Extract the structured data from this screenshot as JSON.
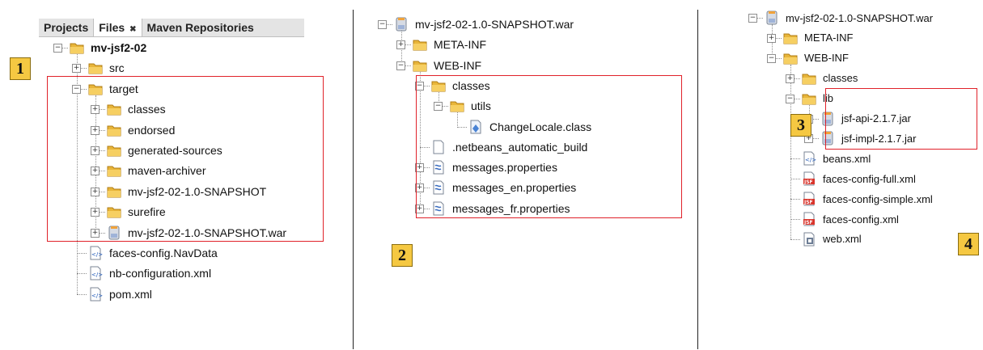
{
  "tabs": [
    {
      "label": "Projects",
      "close": ""
    },
    {
      "label": "Files",
      "close": "✖"
    },
    {
      "label": "Maven Repositories",
      "close": ""
    }
  ],
  "callouts": [
    "1",
    "2",
    "3",
    "4"
  ],
  "panel1": {
    "rows": [
      {
        "label": "mv-jsf2-02",
        "icon": "folder-icon",
        "bold": true,
        "exp": "−"
      },
      {
        "label": "src",
        "icon": "folder-icon",
        "exp": "+"
      },
      {
        "label": "target",
        "icon": "folder-icon",
        "exp": "−"
      },
      {
        "label": "classes",
        "icon": "folder-icon",
        "exp": "+"
      },
      {
        "label": "endorsed",
        "icon": "folder-icon",
        "exp": "+"
      },
      {
        "label": "generated-sources",
        "icon": "folder-icon",
        "exp": "+"
      },
      {
        "label": "maven-archiver",
        "icon": "folder-icon",
        "exp": "+"
      },
      {
        "label": "mv-jsf2-02-1.0-SNAPSHOT",
        "icon": "folder-icon",
        "exp": "+"
      },
      {
        "label": "surefire",
        "icon": "folder-icon",
        "exp": "+"
      },
      {
        "label": "mv-jsf2-02-1.0-SNAPSHOT.war",
        "icon": "jar-icon",
        "exp": "+"
      },
      {
        "label": "faces-config.NavData",
        "icon": "xml-file-icon",
        "exp": ""
      },
      {
        "label": "nb-configuration.xml",
        "icon": "xml-file-icon",
        "exp": ""
      },
      {
        "label": "pom.xml",
        "icon": "xml-file-icon",
        "exp": ""
      }
    ]
  },
  "panel2": {
    "rows": [
      {
        "label": "mv-jsf2-02-1.0-SNAPSHOT.war",
        "icon": "jar-icon",
        "exp": "−"
      },
      {
        "label": "META-INF",
        "icon": "folder-icon",
        "exp": "+"
      },
      {
        "label": "WEB-INF",
        "icon": "folder-icon",
        "exp": "−"
      },
      {
        "label": "classes",
        "icon": "folder-icon",
        "exp": "−"
      },
      {
        "label": "utils",
        "icon": "folder-icon",
        "exp": "−"
      },
      {
        "label": "ChangeLocale.class",
        "icon": "class-file-icon",
        "exp": ""
      },
      {
        "label": ".netbeans_automatic_build",
        "icon": "file-icon",
        "exp": ""
      },
      {
        "label": "messages.properties",
        "icon": "properties-file-icon",
        "exp": "+"
      },
      {
        "label": "messages_en.properties",
        "icon": "properties-file-icon",
        "exp": "+"
      },
      {
        "label": "messages_fr.properties",
        "icon": "properties-file-icon",
        "exp": "+"
      }
    ]
  },
  "panel3": {
    "rows": [
      {
        "label": "mv-jsf2-02-1.0-SNAPSHOT.war",
        "icon": "jar-icon",
        "exp": "−"
      },
      {
        "label": "META-INF",
        "icon": "folder-icon",
        "exp": "+"
      },
      {
        "label": "WEB-INF",
        "icon": "folder-icon",
        "exp": "−"
      },
      {
        "label": "classes",
        "icon": "folder-icon",
        "exp": "+"
      },
      {
        "label": "lib",
        "icon": "folder-icon",
        "exp": "−"
      },
      {
        "label": "jsf-api-2.1.7.jar",
        "icon": "jar-icon",
        "exp": "+"
      },
      {
        "label": "jsf-impl-2.1.7.jar",
        "icon": "jar-icon",
        "exp": "+"
      },
      {
        "label": "beans.xml",
        "icon": "xml-file-icon",
        "exp": ""
      },
      {
        "label": "faces-config-full.xml",
        "icon": "jsf-file-icon",
        "exp": ""
      },
      {
        "label": "faces-config-simple.xml",
        "icon": "jsf-file-icon",
        "exp": ""
      },
      {
        "label": "faces-config.xml",
        "icon": "jsf-file-icon",
        "exp": ""
      },
      {
        "label": "web.xml",
        "icon": "webxml-file-icon",
        "exp": ""
      }
    ]
  },
  "colors": {
    "highlight": "#e0222a",
    "callout": "#f5c842",
    "folder": "#e8b53a"
  }
}
